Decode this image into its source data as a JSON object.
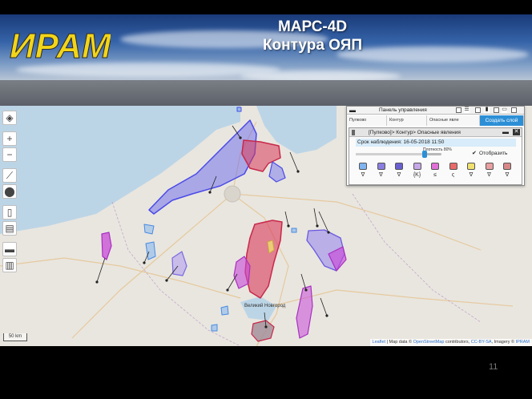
{
  "slide": {
    "title_line1": "МАРС-4D",
    "title_line2": "Контура ОЯП",
    "logo_text": "ИРАМ",
    "page_number": "11"
  },
  "map": {
    "toolbar": [
      {
        "icon": "layers-icon",
        "glyph": "◈"
      },
      {
        "icon": "zoom-in-icon",
        "glyph": "+"
      },
      {
        "icon": "zoom-out-icon",
        "glyph": "−"
      },
      {
        "icon": "measure-icon",
        "glyph": "⟋"
      },
      {
        "icon": "marker-icon",
        "glyph": "⬤"
      },
      {
        "icon": "document-icon",
        "glyph": "▯"
      },
      {
        "icon": "clipboard-icon",
        "glyph": "▤"
      },
      {
        "icon": "print-icon",
        "glyph": "▬"
      },
      {
        "icon": "chart-icon",
        "glyph": "▥"
      }
    ],
    "scale_label": "50 km",
    "city_label": "Великий Новгород",
    "attribution": {
      "leaflet": "Leaflet",
      "text": " | Map data © ",
      "osm": "OpenStreetMap",
      "contributors": " contributors, ",
      "license": "CC-BY-SA",
      "imagery": ", Imagery © ",
      "provider": "IPRAM"
    }
  },
  "panel": {
    "title": "Панель управления",
    "tabs": [
      "Пулково",
      "Контур",
      "Опасные явле",
      "Создать слой"
    ],
    "layer_title": "[Пулково]> Контур> Опасные явления",
    "observation_time": "Срок наблюдения: 16-05-2018 11:50",
    "density_label": "Плотность 80%",
    "density_value": 0.8,
    "show_label": "Отобразить",
    "show_checked": true,
    "swatches": [
      {
        "color": "#7fb4f0",
        "symbol": "∇"
      },
      {
        "color": "#8a7fe0",
        "symbol": "∇"
      },
      {
        "color": "#6a5fd0",
        "symbol": "∇"
      },
      {
        "color": "#c6a8e8",
        "symbol": "{K}"
      },
      {
        "color": "#e070d8",
        "symbol": "≤"
      },
      {
        "color": "#e86a6a",
        "symbol": "ς"
      },
      {
        "color": "#f0e070",
        "symbol": "∇"
      },
      {
        "color": "#e8a0a0",
        "symbol": "∇"
      },
      {
        "color": "#d88888",
        "symbol": "∇"
      }
    ]
  },
  "colors": {
    "title": "#ffffff",
    "logo": "#f2d519",
    "map_bg": "#e9e6df",
    "water": "#bcd5e6",
    "contour_blue": "#5a5af0",
    "contour_magenta": "#c84ad8",
    "contour_red": "#d83a5a",
    "accent": "#2c8fd6"
  }
}
